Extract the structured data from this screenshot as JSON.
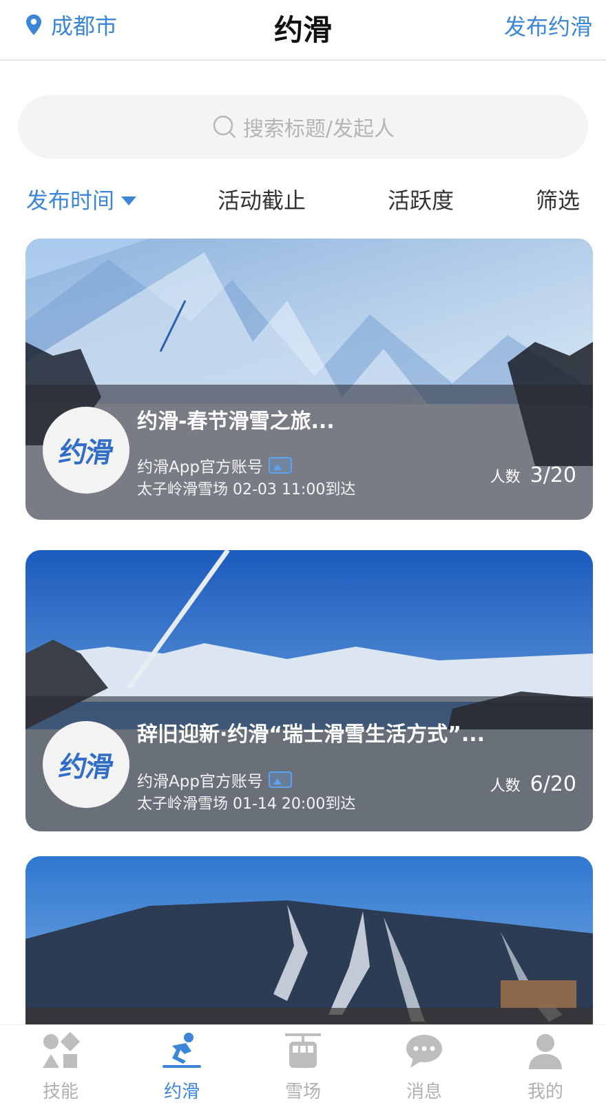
{
  "header": {
    "location": "成都市",
    "title": "约滑",
    "publish_label": "发布约滑"
  },
  "search": {
    "placeholder": "搜索标题/发起人"
  },
  "sort_tabs": [
    {
      "label": "发布时间",
      "active": true
    },
    {
      "label": "活动截止",
      "active": false
    },
    {
      "label": "活跃度",
      "active": false
    },
    {
      "label": "筛选",
      "active": false
    }
  ],
  "cards": [
    {
      "avatar_text": "约滑",
      "title": "约滑-春节滑雪之旅...",
      "author": "约滑App官方账号",
      "meta": "太子岭滑雪场 02-03 11:00到达",
      "count_label": "人数",
      "count": "3/20"
    },
    {
      "avatar_text": "约滑",
      "title": "辞旧迎新·约滑“瑞士滑雪生活方式”...",
      "author": "约滑App官方账号",
      "meta": "太子岭滑雪场 01-14 20:00到达",
      "count_label": "人数",
      "count": "6/20"
    }
  ],
  "tabbar": [
    {
      "label": "技能",
      "icon": "skills-icon",
      "active": false
    },
    {
      "label": "约滑",
      "icon": "skier-icon",
      "active": true
    },
    {
      "label": "雪场",
      "icon": "cable-car-icon",
      "active": false
    },
    {
      "label": "消息",
      "icon": "chat-bubble-icon",
      "active": false
    },
    {
      "label": "我的",
      "icon": "profile-icon",
      "active": false
    }
  ],
  "colors": {
    "accent": "#3b86d6",
    "inactive": "#b0b0b0"
  }
}
